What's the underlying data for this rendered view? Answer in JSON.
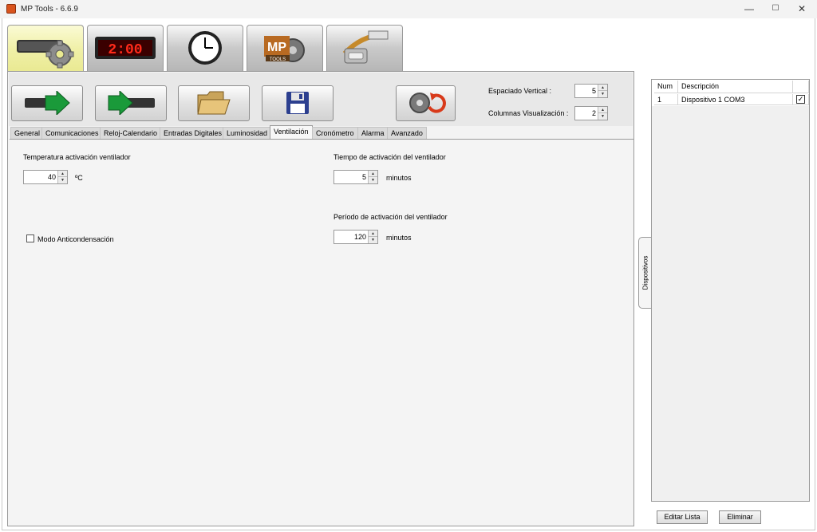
{
  "window": {
    "title": "MP Tools - 6.6.9",
    "minimize": "—",
    "maximize": "☐",
    "close": "✕"
  },
  "top_tabs": [
    {
      "icon": "settings-gear-icon",
      "active": true
    },
    {
      "icon": "led-display-icon",
      "display_text": "2:00"
    },
    {
      "icon": "clock-icon"
    },
    {
      "icon": "mp-tools-logo-icon",
      "logo_text": "MP",
      "logo_sub": "TOOLS"
    },
    {
      "icon": "serial-cable-icon"
    }
  ],
  "toolbar": {
    "buttons": [
      {
        "name": "send-to-device-button",
        "icon": "device-send-arrow-icon"
      },
      {
        "name": "read-from-device-button",
        "icon": "device-read-arrow-icon"
      },
      {
        "name": "open-file-button",
        "icon": "folder-icon"
      },
      {
        "name": "save-file-button",
        "icon": "floppy-disk-icon"
      },
      {
        "name": "reset-settings-button",
        "icon": "gear-reset-icon"
      }
    ],
    "vertical_spacing_label": "Espaciado Vertical :",
    "vertical_spacing_value": "5",
    "columns_label": "Columnas Visualización :",
    "columns_value": "2"
  },
  "sub_tabs": [
    {
      "label": "General"
    },
    {
      "label": "Comunicaciones"
    },
    {
      "label": "Reloj-Calendario"
    },
    {
      "label": "Entradas Digitales"
    },
    {
      "label": "Luminosidad"
    },
    {
      "label": "Ventilación",
      "active": true
    },
    {
      "label": "Cronómetro"
    },
    {
      "label": "Alarma"
    },
    {
      "label": "Avanzado"
    }
  ],
  "ventilation": {
    "temp_label": "Temperatura activación ventilador",
    "temp_value": "40",
    "temp_unit": "ºC",
    "anticondensation_label": "Modo Anticondensación",
    "anticondensation_checked": false,
    "activation_time_label": "Tiempo de activación del ventilador",
    "activation_time_value": "5",
    "activation_time_unit": "minutos",
    "activation_period_label": "Período de activación del ventilador",
    "activation_period_value": "120",
    "activation_period_unit": "minutos"
  },
  "devices_panel": {
    "side_tab_label": "Dispositivos",
    "columns": [
      "Num",
      "Descripción"
    ],
    "rows": [
      {
        "num": "1",
        "description": "Dispositivo 1 COM3",
        "checked": true
      }
    ],
    "edit_button": "Editar Lista",
    "delete_button": "Eliminar"
  },
  "colors": {
    "active_tab": "#f0f0a8",
    "panel_bg": "#f3f3f3",
    "arrow_green": "#1a9a3a"
  }
}
